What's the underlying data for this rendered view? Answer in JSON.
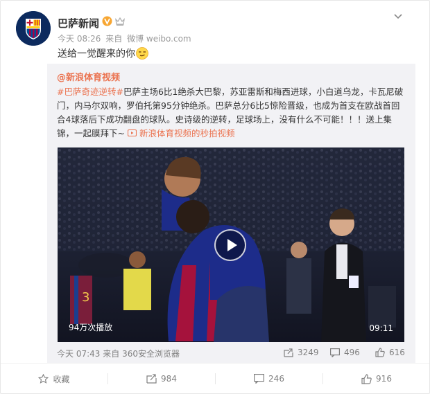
{
  "post": {
    "author": "巴萨新闻",
    "time": "今天 08:26",
    "via_prefix": "来自",
    "source": "微博 weibo.com",
    "text": "送给一觉醒来的你"
  },
  "repost": {
    "author": "@新浪体育视频",
    "hashtag": "#巴萨奇迹逆转#",
    "body": "巴萨主场6比1绝杀大巴黎，苏亚雷斯和梅西进球，小白道乌龙，卡瓦尼破门，内马尔双响，罗伯托第95分钟绝杀。巴萨总分6比5惊险晋级，也成为首支在欧战首回合4球落后下成功翻盘的球队。史诗级的逆转，足球场上，没有什么不可能！！！送上集锦，一起膜拜下~",
    "video_link": "新浪体育视频的秒拍视频",
    "video": {
      "plays": "94万次播放",
      "duration": "09:11"
    },
    "time": "今天 07:43",
    "via_prefix": "来自",
    "source": "360安全浏览器",
    "reposts": "3249",
    "comments": "496",
    "likes": "616"
  },
  "footer": {
    "favorite": "收藏",
    "repost": "984",
    "comment": "246",
    "like": "916"
  },
  "colors": {
    "link": "#eb7350",
    "verified": "#f7a632",
    "text": "#333333",
    "muted": "#999999"
  }
}
